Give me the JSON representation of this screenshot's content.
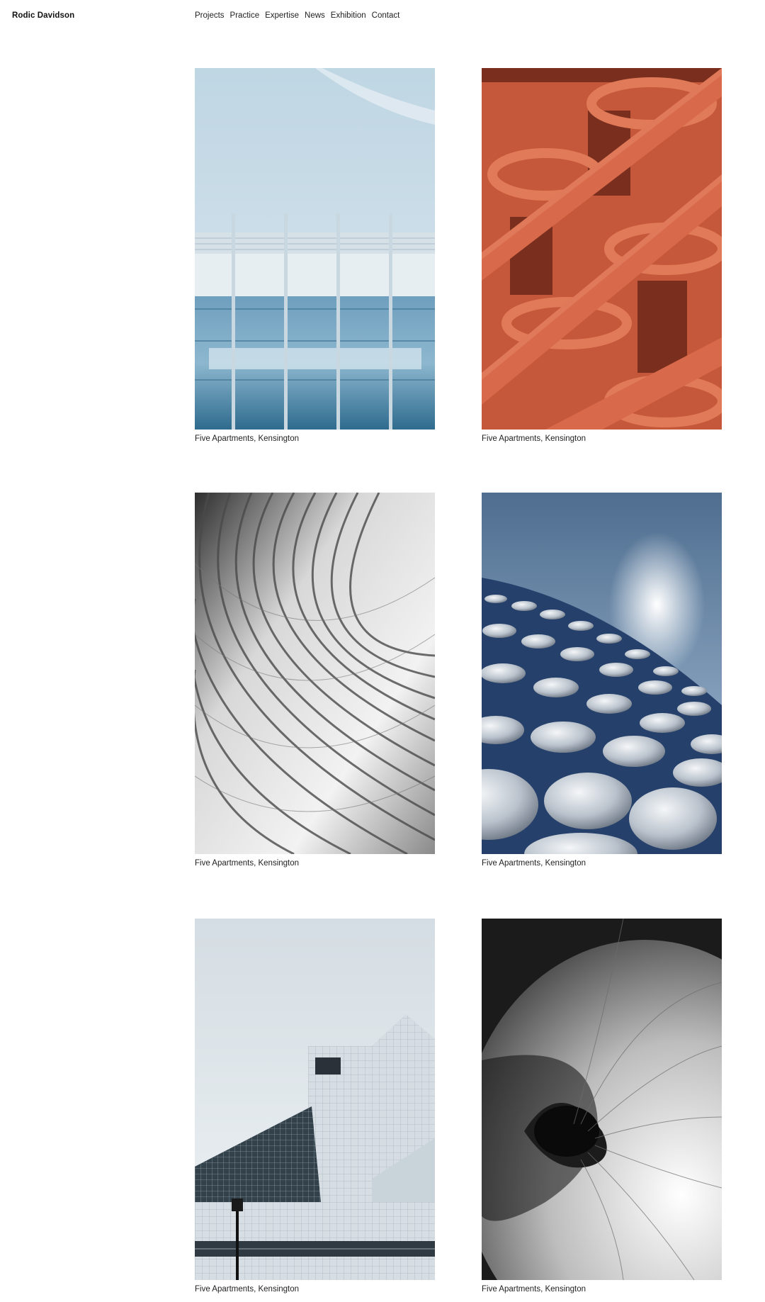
{
  "header": {
    "brand": "Rodic Davidson",
    "nav": [
      "Projects",
      "Practice",
      "Expertise",
      "News",
      "Exhibition",
      "Contact"
    ]
  },
  "projects": [
    {
      "caption": "Five Apartments, Kensington",
      "image": "glass-facade-columns"
    },
    {
      "caption": "Five Apartments, Kensington",
      "image": "orange-balcony-building"
    },
    {
      "caption": "Five Apartments, Kensington",
      "image": "curved-lattice-facade"
    },
    {
      "caption": "Five Apartments, Kensington",
      "image": "disc-clad-building"
    },
    {
      "caption": "Five Apartments, Kensington",
      "image": "angular-tiled-building"
    },
    {
      "caption": "Five Apartments, Kensington",
      "image": "spiral-concrete-ceiling"
    }
  ],
  "colors": {
    "background": "#ffffff",
    "text": "#111111"
  }
}
